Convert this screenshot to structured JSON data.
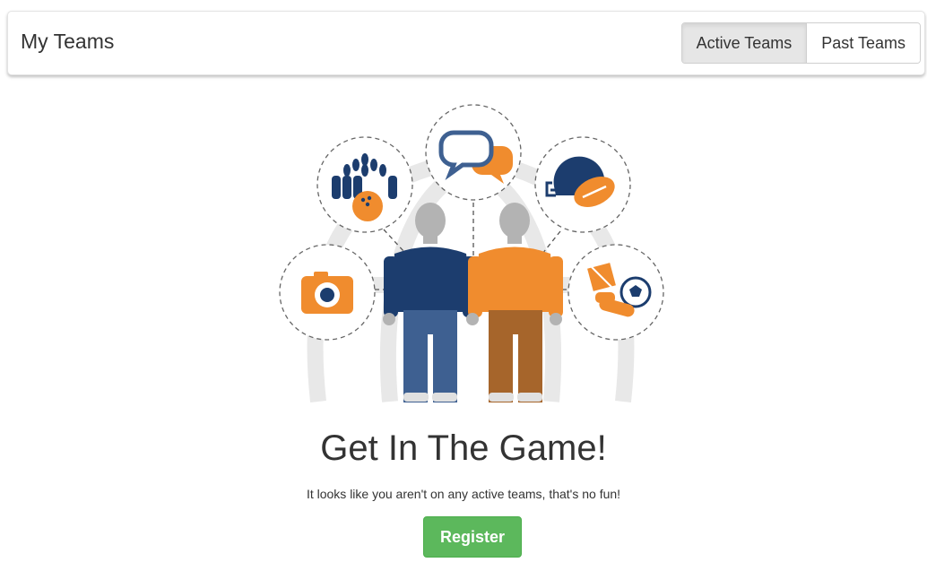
{
  "header": {
    "title": "My Teams",
    "tabs": [
      {
        "label": "Active Teams",
        "active": true
      },
      {
        "label": "Past Teams",
        "active": false
      }
    ]
  },
  "empty_state": {
    "headline": "Get In The Game!",
    "message": "It looks like you aren't on any active teams, that's no fun!",
    "register_label": "Register"
  },
  "illustration": {
    "icons": [
      "bowling-icon",
      "chat-bubbles-icon",
      "football-helmet-icon",
      "camera-icon",
      "soccer-gear-icon"
    ],
    "colors": {
      "navy": "#1c3d6e",
      "orange": "#f08c2e",
      "gray": "#b3b3b3",
      "light_gray": "#e8e8e8"
    }
  },
  "colors": {
    "register_button": "#5cb85c"
  }
}
